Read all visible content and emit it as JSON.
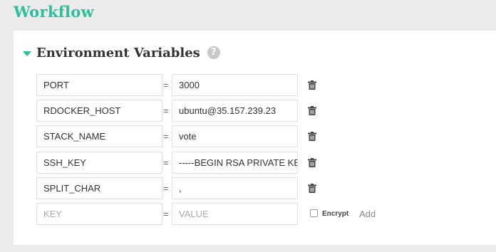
{
  "page": {
    "title": "Workflow"
  },
  "section": {
    "title": "Environment Variables",
    "help_icon": "question-circle-icon",
    "caret_icon": "caret-down-icon"
  },
  "variables": [
    {
      "key": "PORT",
      "value": "3000"
    },
    {
      "key": "RDOCKER_HOST",
      "value": "ubuntu@35.157.239.23"
    },
    {
      "key": "STACK_NAME",
      "value": "vote"
    },
    {
      "key": "SSH_KEY",
      "value": "-----BEGIN RSA PRIVATE KEY"
    },
    {
      "key": "SPLIT_CHAR",
      "value": ","
    }
  ],
  "separator": "=",
  "new_row": {
    "key_placeholder": "KEY",
    "value_placeholder": "VALUE",
    "encrypt_label": "Encrypt",
    "add_label": "Add"
  },
  "colors": {
    "accent": "#2bbf9b",
    "background": "#ebebeb"
  }
}
